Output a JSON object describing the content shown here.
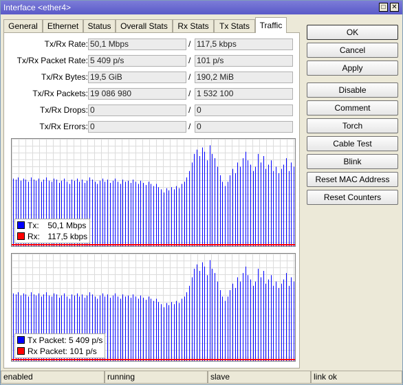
{
  "window": {
    "title": "Interface <ether4>",
    "minimize_icon": "restore-icon",
    "close_icon": "close-icon"
  },
  "tabs": [
    {
      "label": "General",
      "active": false
    },
    {
      "label": "Ethernet",
      "active": false
    },
    {
      "label": "Status",
      "active": false
    },
    {
      "label": "Overall Stats",
      "active": false
    },
    {
      "label": "Rx Stats",
      "active": false
    },
    {
      "label": "Tx Stats",
      "active": false
    },
    {
      "label": "Traffic",
      "active": true
    }
  ],
  "stats": [
    {
      "label": "Tx/Rx Rate:",
      "tx": "50,1 Mbps",
      "rx": "117,5 kbps"
    },
    {
      "label": "Tx/Rx Packet Rate:",
      "tx": "5 409 p/s",
      "rx": "101 p/s"
    },
    {
      "label": "Tx/Rx Bytes:",
      "tx": "19,5 GiB",
      "rx": "190,2 MiB"
    },
    {
      "label": "Tx/Rx Packets:",
      "tx": "19 086 980",
      "rx": "1 532 100"
    },
    {
      "label": "Tx/Rx Drops:",
      "tx": "0",
      "rx": "0"
    },
    {
      "label": "Tx/Rx Errors:",
      "tx": "0",
      "rx": "0"
    }
  ],
  "separator": "/",
  "graphs": {
    "traffic": {
      "legend": [
        {
          "name": "Tx:",
          "value": "50,1 Mbps",
          "color": "#0000ff"
        },
        {
          "name": "Rx:",
          "value": "117,5 kbps",
          "color": "#ff0000"
        }
      ]
    },
    "packets": {
      "legend": [
        {
          "name": "Tx Packet:",
          "value": "5 409 p/s",
          "color": "#0000ff"
        },
        {
          "name": "Rx Packet:",
          "value": "101 p/s",
          "color": "#ff0000"
        }
      ]
    }
  },
  "chart_data": {
    "type": "bar",
    "tx_levels": [
      0.63,
      0.62,
      0.64,
      0.61,
      0.63,
      0.62,
      0.6,
      0.64,
      0.62,
      0.61,
      0.63,
      0.6,
      0.62,
      0.64,
      0.61,
      0.6,
      0.63,
      0.62,
      0.59,
      0.61,
      0.63,
      0.6,
      0.58,
      0.62,
      0.61,
      0.63,
      0.6,
      0.62,
      0.59,
      0.61,
      0.64,
      0.62,
      0.6,
      0.58,
      0.61,
      0.63,
      0.6,
      0.62,
      0.59,
      0.61,
      0.63,
      0.6,
      0.58,
      0.62,
      0.6,
      0.61,
      0.59,
      0.62,
      0.6,
      0.58,
      0.61,
      0.59,
      0.57,
      0.6,
      0.58,
      0.56,
      0.58,
      0.55,
      0.53,
      0.5,
      0.54,
      0.52,
      0.55,
      0.53,
      0.56,
      0.54,
      0.58,
      0.6,
      0.64,
      0.7,
      0.78,
      0.86,
      0.9,
      0.84,
      0.92,
      0.88,
      0.8,
      0.94,
      0.86,
      0.82,
      0.74,
      0.66,
      0.6,
      0.56,
      0.6,
      0.66,
      0.72,
      0.68,
      0.78,
      0.74,
      0.82,
      0.88,
      0.8,
      0.76,
      0.7,
      0.74,
      0.86,
      0.78,
      0.84,
      0.72,
      0.76,
      0.8,
      0.7,
      0.74,
      0.68,
      0.72,
      0.76,
      0.82,
      0.7,
      0.78,
      0.74
    ],
    "rx_level": 0.01
  },
  "buttons": [
    {
      "label": "OK",
      "default": true
    },
    {
      "label": "Cancel",
      "default": false
    },
    {
      "label": "Apply",
      "default": false
    },
    {
      "label": "Disable",
      "default": false
    },
    {
      "label": "Comment",
      "default": false
    },
    {
      "label": "Torch",
      "default": false
    },
    {
      "label": "Cable Test",
      "default": false
    },
    {
      "label": "Blink",
      "default": false
    },
    {
      "label": "Reset MAC Address",
      "default": false
    },
    {
      "label": "Reset Counters",
      "default": false
    }
  ],
  "statusbar": [
    "enabled",
    "running",
    "slave",
    "link ok"
  ]
}
